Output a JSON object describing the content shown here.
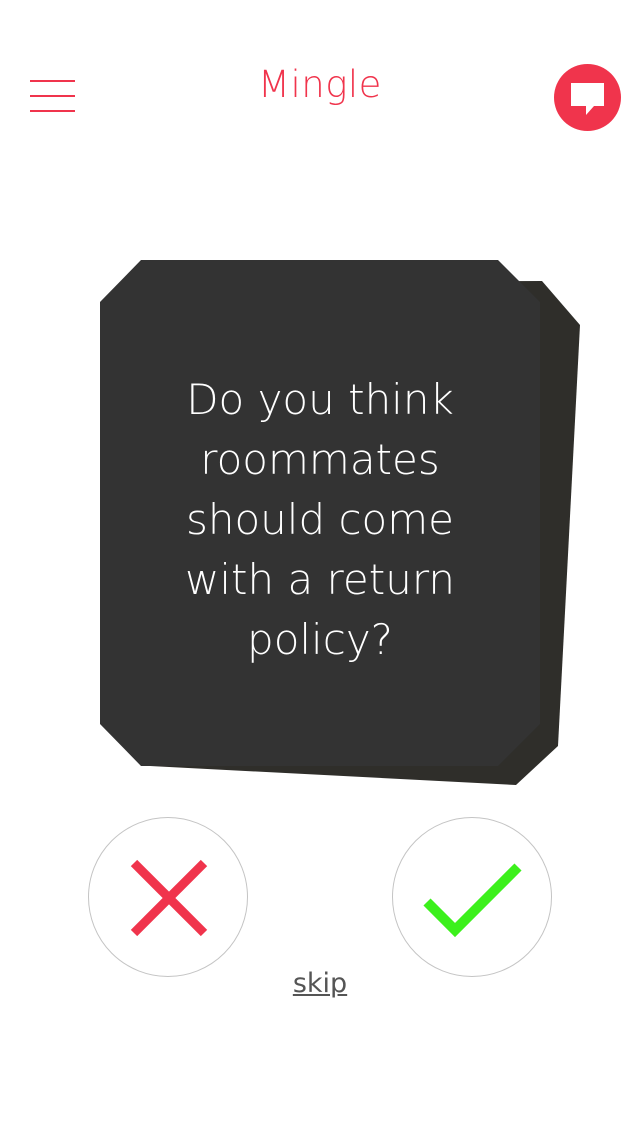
{
  "header": {
    "title": "Mingle",
    "menu_icon": "hamburger-menu-icon",
    "chat_icon": "chat-bubble-icon"
  },
  "card": {
    "question": "Do you think\nroommates\nshould come\nwith a return\npolicy?"
  },
  "actions": {
    "no_icon": "cross-icon",
    "yes_icon": "checkmark-icon",
    "skip_label": "skip"
  },
  "colors": {
    "accent": "#f0344c",
    "card": "#333333",
    "card_shadow": "#2f2e2a",
    "no": "#f0344c",
    "yes": "#3cf01c"
  }
}
